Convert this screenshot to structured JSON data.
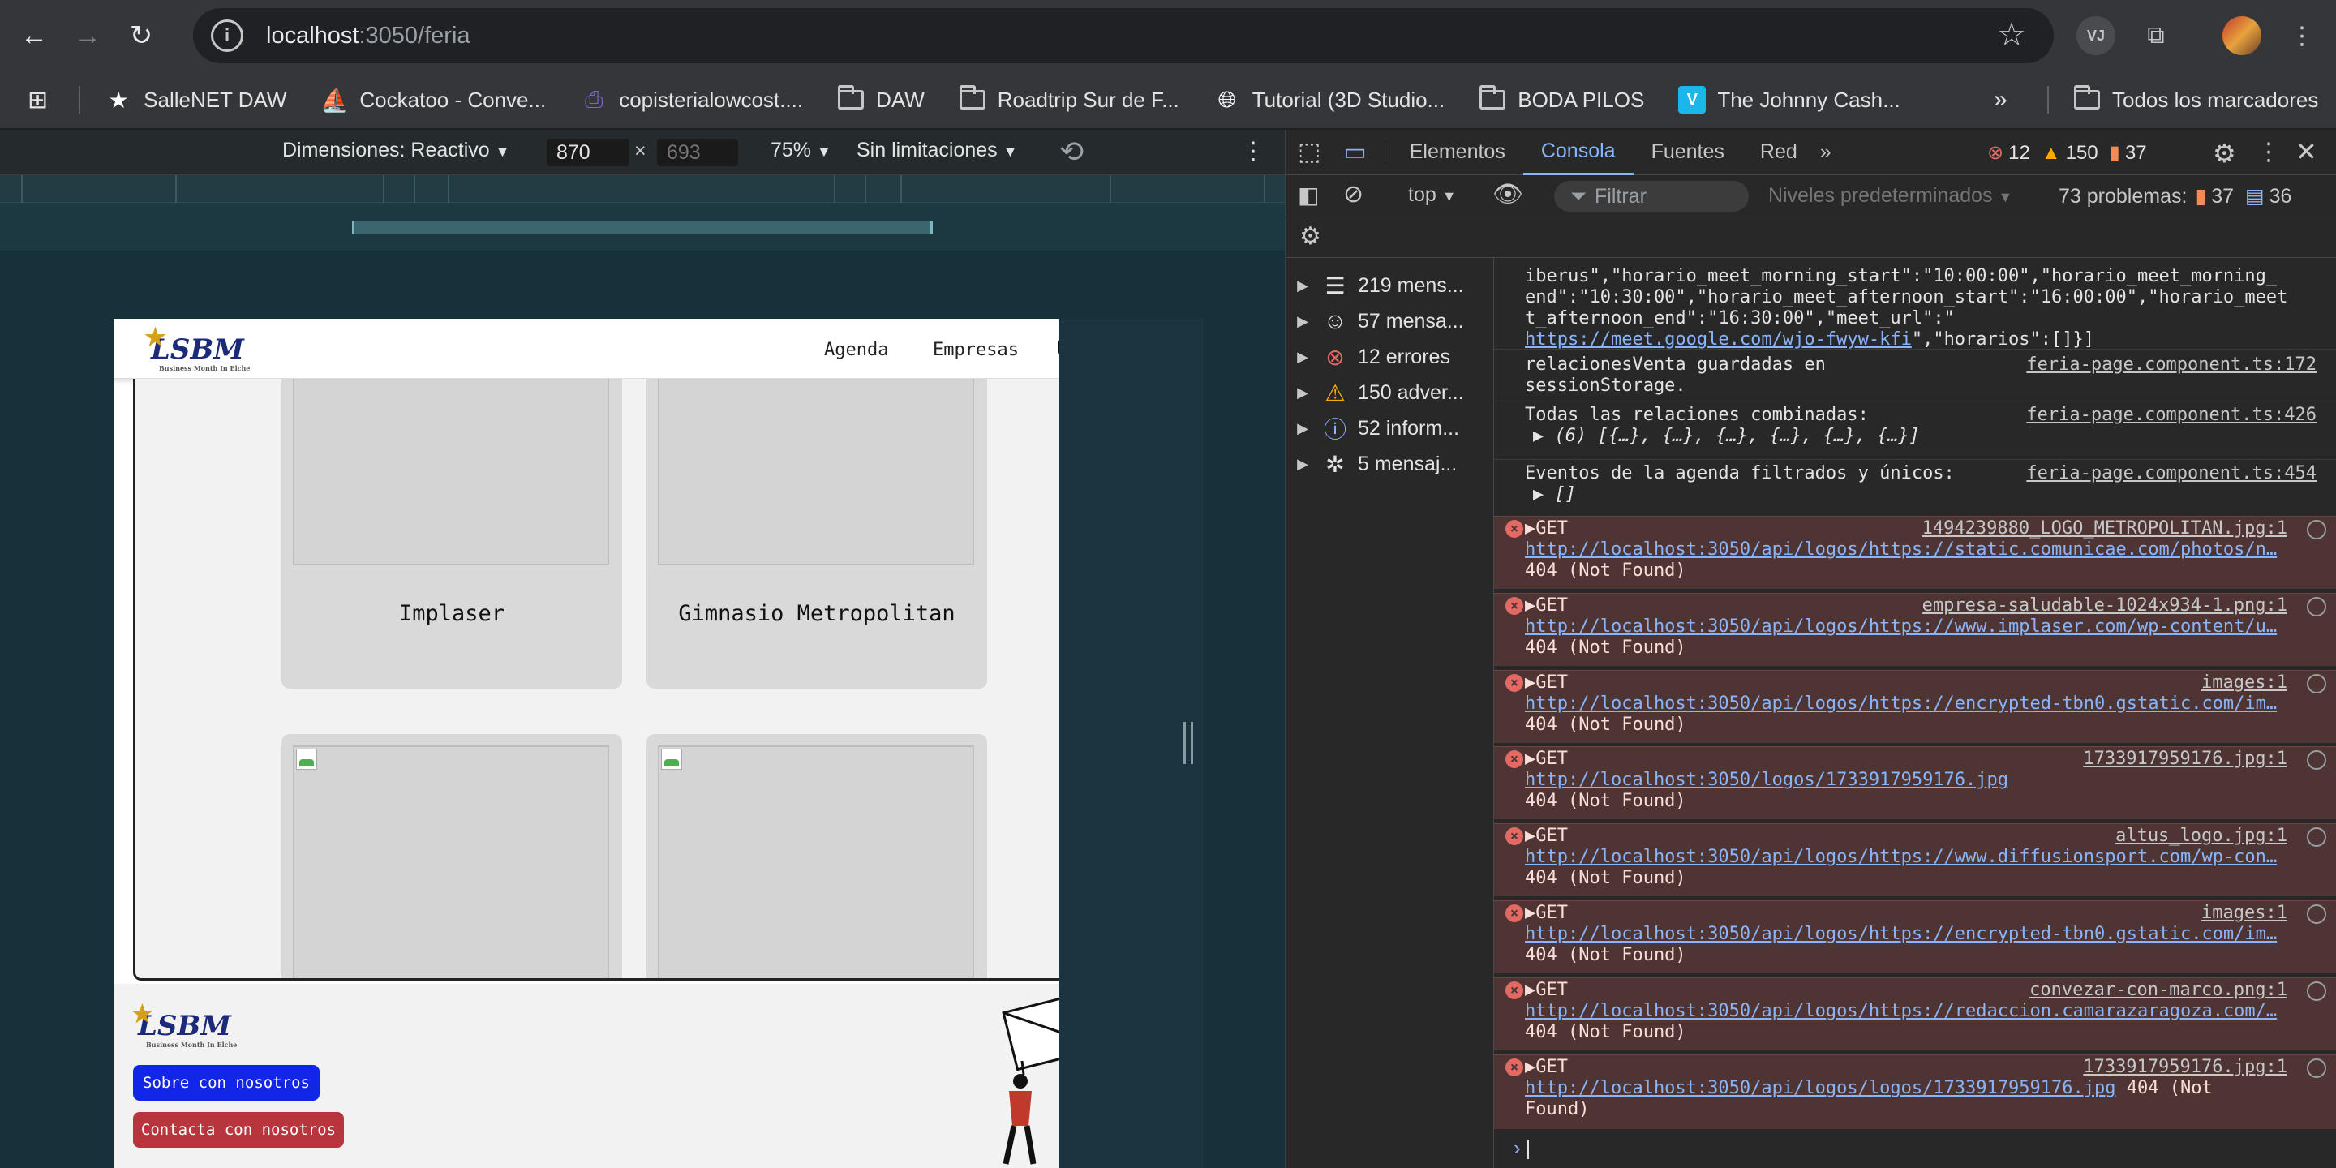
{
  "browser": {
    "url_host": "localhost",
    "url_path": ":3050/feria",
    "bookmarks": [
      {
        "label": "SalleNET DAW",
        "icon": "star-icon"
      },
      {
        "label": "Cockatoo - Conve...",
        "icon": "cockatoo-icon"
      },
      {
        "label": "copisterialowcost....",
        "icon": "copisteria-icon"
      },
      {
        "label": "DAW",
        "icon": "folder-icon"
      },
      {
        "label": "Roadtrip Sur de F...",
        "icon": "folder-icon"
      },
      {
        "label": "Tutorial (3D Studio...",
        "icon": "globe-icon"
      },
      {
        "label": "BODA PILOS",
        "icon": "folder-icon"
      },
      {
        "label": "The Johnny Cash...",
        "icon": "vimeo-icon"
      }
    ],
    "all_bookmarks": "Todos los marcadores",
    "profile_badge": "VJ"
  },
  "device_toolbar": {
    "dimensions_label": "Dimensiones: Reactivo",
    "width": "870",
    "times": "×",
    "height": "693",
    "zoom": "75%",
    "throttle": "Sin limitaciones"
  },
  "site": {
    "logo_text": "LSBM",
    "logo_tagline": "Business Month In Elche",
    "nav": [
      "Agenda",
      "Empresas"
    ],
    "companies": [
      "Implaser",
      "Gimnasio Metropolitan"
    ],
    "footer_about": "Sobre con nosotros",
    "footer_contact": "Contacta con nosotros"
  },
  "devtools": {
    "tabs": [
      "Elementos",
      "Consola",
      "Fuentes",
      "Red"
    ],
    "active_tab": "Consola",
    "counts": {
      "errors": "12",
      "warnings": "150",
      "issues": "37"
    },
    "context": "top",
    "filter_placeholder": "Filtrar",
    "levels": "Niveles predeterminados",
    "problems_label": "73 problemas:",
    "problems_issues": "37",
    "problems_info": "36",
    "sidebar": [
      {
        "label": "219 mens...",
        "icon": "list-icon"
      },
      {
        "label": "57 mensa...",
        "icon": "user-icon"
      },
      {
        "label": "12 errores",
        "icon": "error-icon"
      },
      {
        "label": "150 adver...",
        "icon": "warning-icon"
      },
      {
        "label": "52 inform...",
        "icon": "info-icon"
      },
      {
        "label": "5 mensaj...",
        "icon": "bug-icon"
      }
    ],
    "log_top": [
      "iberus\",\"horario_meet_morning_start\":\"10:00:00\",\"horario_meet_morning_",
      "end\":\"10:30:00\",\"horario_meet_afternoon_start\":\"16:00:00\",\"horario_meet",
      "t_afternoon_end\":\"16:30:00\",\"meet_url\":\""
    ],
    "log_top_link": "https://meet.google.com/wjo-fwyw-kfi",
    "log_top_tail": "\",\"horarios\":[]}]",
    "logs": [
      {
        "text1": "relacionesVenta guardadas en",
        "text2": "sessionStorage.",
        "source": "feria-page.component.ts:172"
      },
      {
        "text1": "Todas las relaciones combinadas:",
        "text2": "▶ (6) [{…}, {…}, {…}, {…}, {…}, {…}]",
        "source": "feria-page.component.ts:426"
      },
      {
        "text1": "Eventos de la agenda filtrados y únicos:",
        "text2": "▶ []",
        "source": "feria-page.component.ts:454"
      }
    ],
    "errors": [
      {
        "method": "▶GET",
        "source": "1494239880_LOGO_METROPOLITAN.jpg:1",
        "url": "http://localhost:3050/api/logos/https://static.comunicae.com/photos/n…",
        "status": "404 (Not Found)"
      },
      {
        "method": "▶GET",
        "source": "empresa-saludable-1024x934-1.png:1",
        "url": "http://localhost:3050/api/logos/https://www.implaser.com/wp-content/u…",
        "status": "404 (Not Found)"
      },
      {
        "method": "▶GET",
        "source": "images:1",
        "url": "http://localhost:3050/api/logos/https://encrypted-tbn0.gstatic.com/im…",
        "status": "404 (Not Found)"
      },
      {
        "method": "▶GET",
        "source": "1733917959176.jpg:1",
        "url": "http://localhost:3050/logos/1733917959176.jpg",
        "status": "404 (Not Found)"
      },
      {
        "method": "▶GET",
        "source": "altus_logo.jpg:1",
        "url": "http://localhost:3050/api/logos/https://www.diffusionsport.com/wp-con…",
        "status": "404 (Not Found)"
      },
      {
        "method": "▶GET",
        "source": "images:1",
        "url": "http://localhost:3050/api/logos/https://encrypted-tbn0.gstatic.com/im…",
        "status": "404 (Not Found)"
      },
      {
        "method": "▶GET",
        "source": "convezar-con-marco.png:1",
        "url": "http://localhost:3050/api/logos/https://redaccion.camarazaragoza.com/…",
        "status": "404 (Not Found)"
      },
      {
        "method": "▶GET",
        "source": "1733917959176.jpg:1",
        "url": "http://localhost:3050/api/logos/logos/1733917959176.jpg",
        "status": "404 (Not Found)"
      }
    ],
    "colors": {
      "error_bg": "#4e3534",
      "link": "#8ab4f8",
      "active_tab": "#8ab4f8"
    }
  }
}
